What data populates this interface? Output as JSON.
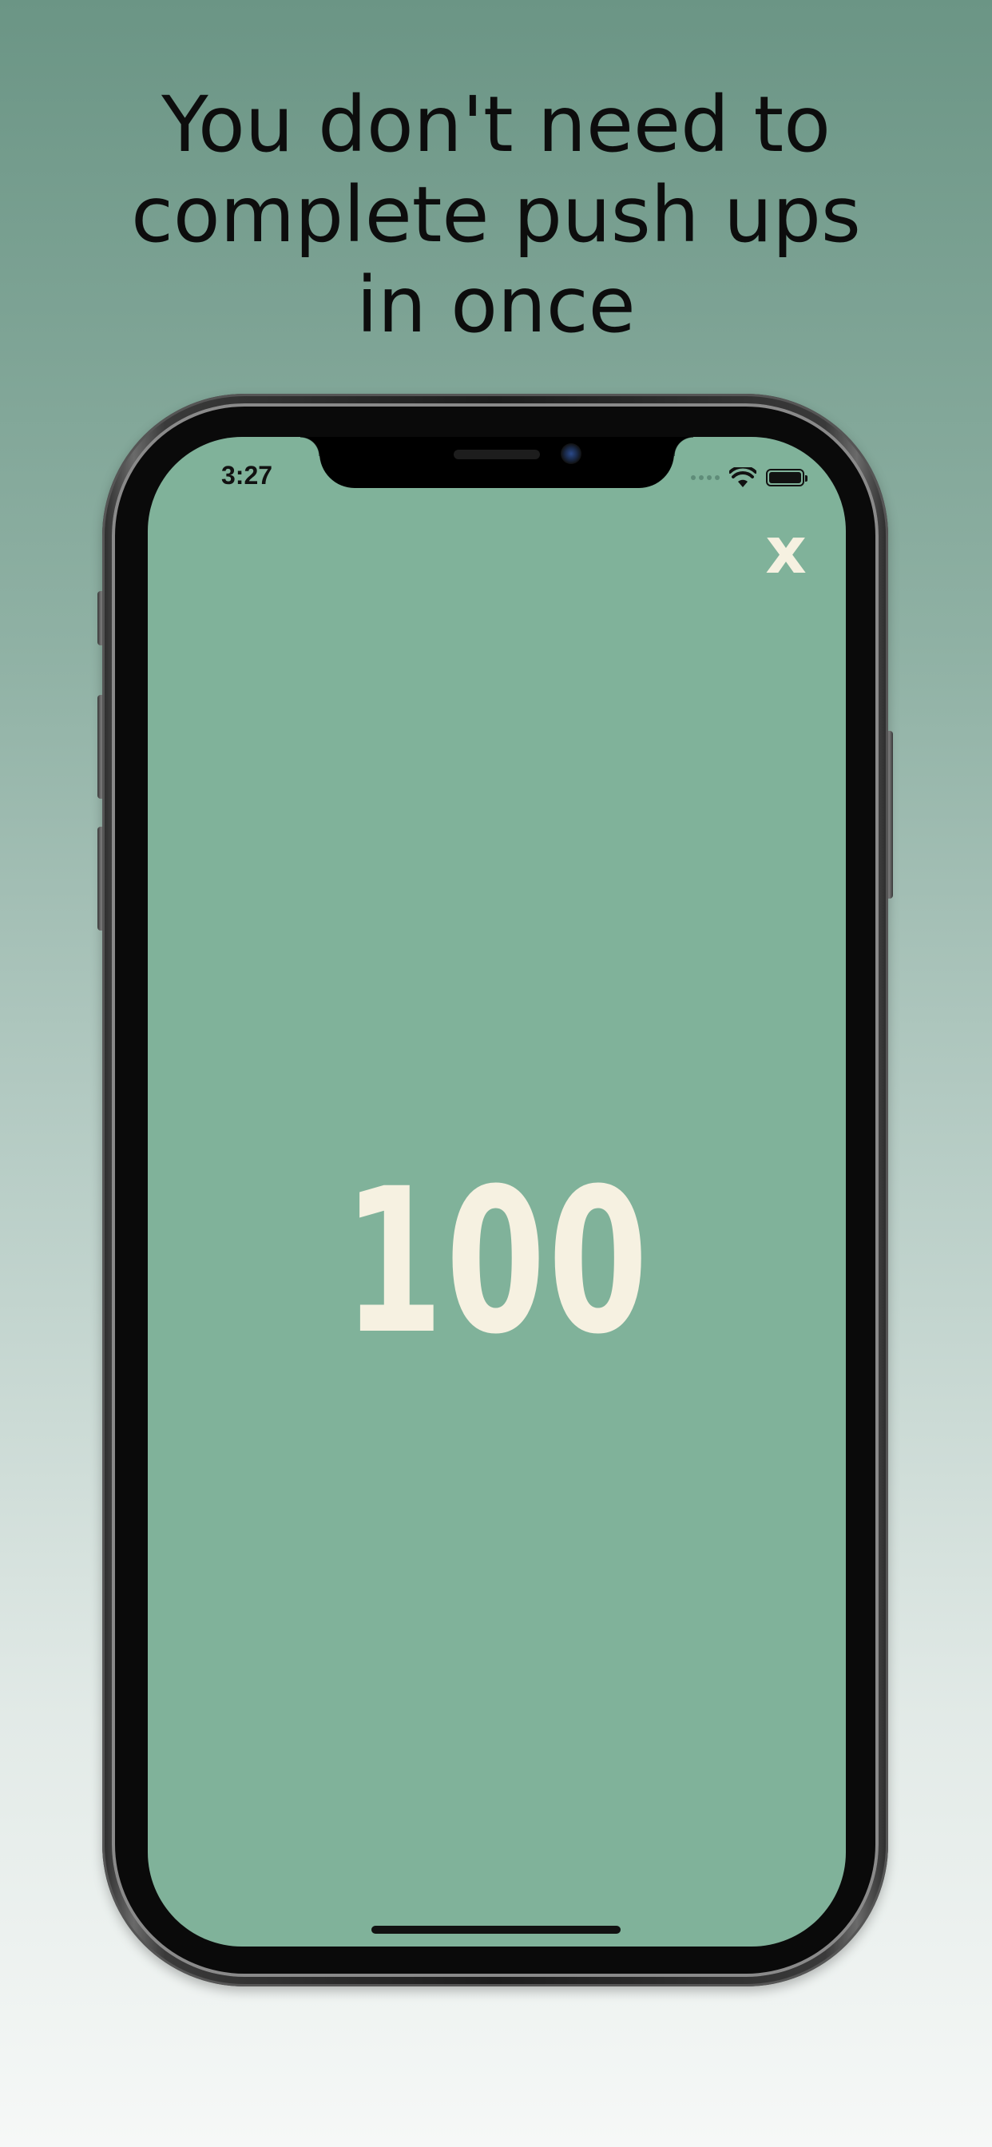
{
  "headline": {
    "line1": "You don't need to",
    "line2": "complete push ups",
    "line3": "in once"
  },
  "status_bar": {
    "time": "3:27",
    "icons": [
      "signal-dots-icon",
      "wifi-icon",
      "battery-icon"
    ]
  },
  "screen": {
    "close_label": "x",
    "counter": "100",
    "background_color": "#80b29a",
    "text_color": "#f6f1e1"
  }
}
